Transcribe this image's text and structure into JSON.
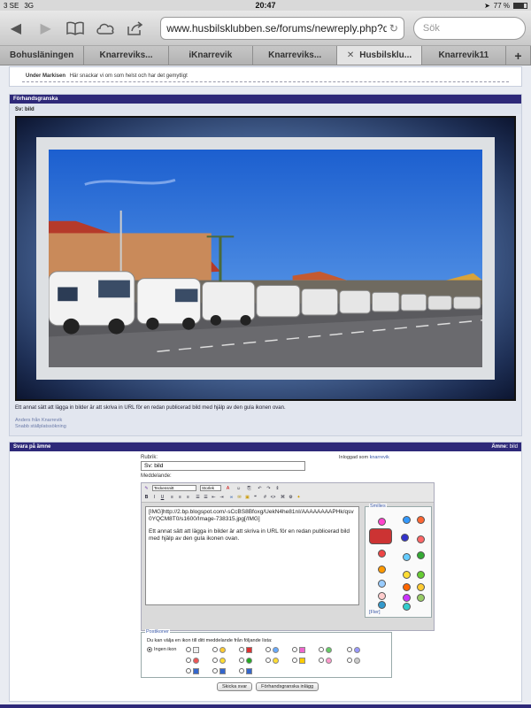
{
  "status": {
    "carrier": "3 SE",
    "network": "3G",
    "time": "20:47",
    "battery": "77 %",
    "battery_fraction": 0.77
  },
  "toolbar": {
    "url": "www.husbilsklubben.se/forums/newreply.php?do",
    "search_placeholder": "Sök"
  },
  "tabs": [
    {
      "label": "Bohusläningen"
    },
    {
      "label": "Knarreviks..."
    },
    {
      "label": "iKnarrevik"
    },
    {
      "label": "Knarreviks..."
    },
    {
      "label": "Husbilsklu...",
      "active": true
    },
    {
      "label": "Knarrevik11"
    }
  ],
  "top_note": {
    "user": "Under Markisen",
    "text": "Här snackar vi om som helst och har det gemytligt"
  },
  "preview": {
    "header": "Förhandsgranska",
    "subject": "Sv: bild",
    "caption": "Ett annat sätt att lägga in bilder är att skriva in URL för en redan publicerad bild med hjälp av den gula ikonen ovan.",
    "link1": "Anders från Knarrevik",
    "link2": "Snabb ställplatssökning"
  },
  "reply": {
    "header": "Svara på ämne",
    "topic_label": "Ämne:",
    "topic_value": "bild",
    "subject_label": "Rubrik:",
    "subject_value": "Sv: bild",
    "logged_in_label": "Inloggad som",
    "logged_in_user": "knarrevik",
    "message_label": "Meddelande:",
    "font_select": "Teckensnitt",
    "size_select": "Storlek",
    "message_line1": "[IMG]http://2.bp.blogspot.com/-sCcBS8Bfoxg/UekN4he81nI/AAAAAAAAPHk/qsv0YQCM8T0/s1600/Image-738315.jpg[/IMG]",
    "message_line2": "Ett annat sätt att lägga in bilder är att skriva in URL för en redan publicerad bild med hjälp av den gula ikonen ovan.",
    "smilies_title": "Smilies",
    "smilies_more": "[Fler]",
    "posticons_title": "Postikoner",
    "posticons_desc": "Du kan välja en ikon till ditt meddelande från följande lista:",
    "no_icon_label": "Ingen ikon",
    "submit_label": "Skicka svar",
    "preview_label": "Förhandsgranska inlägg"
  },
  "colors": {
    "header_bg": "#2e2979",
    "link": "#3c5aa8"
  }
}
